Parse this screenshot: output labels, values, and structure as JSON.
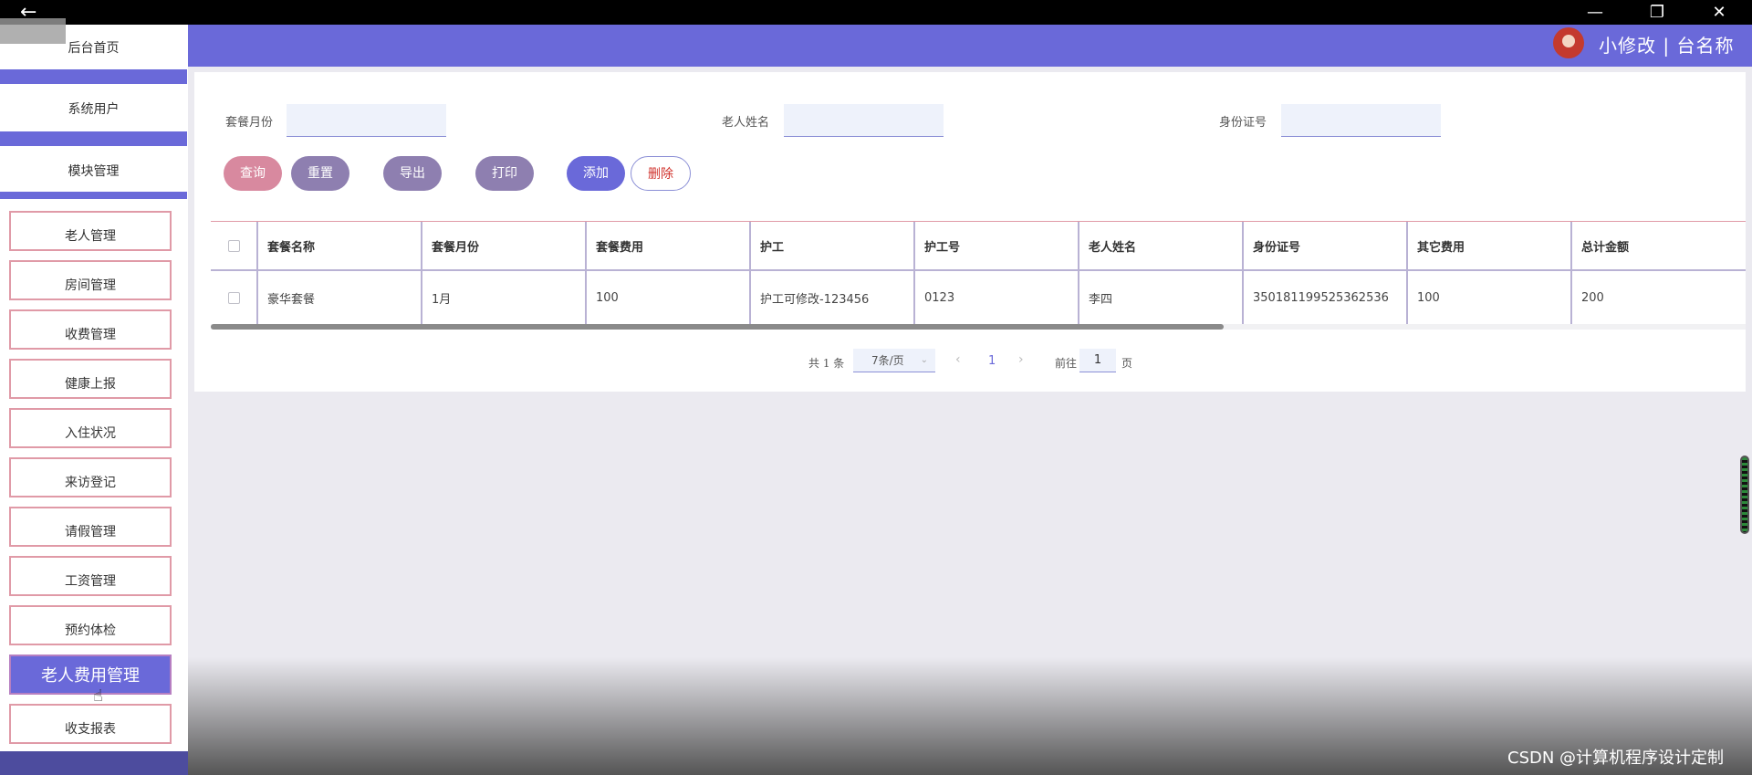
{
  "window": {
    "back_label": "←",
    "minimize_label": "—",
    "restore_label": "❐",
    "close_label": "✕"
  },
  "header": {
    "text": "小修改 | 台名称"
  },
  "sidebar": {
    "top_items": [
      "后台首页",
      "系统用户",
      "模块管理"
    ],
    "items": [
      {
        "label": "老人管理"
      },
      {
        "label": "房间管理"
      },
      {
        "label": "收费管理"
      },
      {
        "label": "健康上报"
      },
      {
        "label": "入住状况"
      },
      {
        "label": "来访登记"
      },
      {
        "label": "请假管理"
      },
      {
        "label": "工资管理"
      },
      {
        "label": "预约体检"
      },
      {
        "label": "老人费用管理",
        "active": true
      },
      {
        "label": "收支报表"
      }
    ]
  },
  "filters": {
    "package_month_label": "套餐月份",
    "elder_name_label": "老人姓名",
    "id_card_label": "身份证号",
    "package_month_value": "",
    "elder_name_value": "",
    "id_card_value": ""
  },
  "buttons": {
    "query": "查询",
    "reset": "重置",
    "export": "导出",
    "print": "打印",
    "add": "添加",
    "delete": "删除"
  },
  "table": {
    "headers": [
      "套餐名称",
      "套餐月份",
      "套餐费用",
      "护工",
      "护工号",
      "老人姓名",
      "身份证号",
      "其它费用",
      "总计金额"
    ],
    "rows": [
      [
        "豪华套餐",
        "1月",
        "100",
        "护工可修改-123456",
        "0123",
        "李四",
        "350181199525362536",
        "100",
        "200"
      ]
    ]
  },
  "pager": {
    "total": "共 1 条",
    "page_size": "7条/页",
    "prev": "‹",
    "current_page": "1",
    "next": "›",
    "goto": "前往",
    "goto_value": "1",
    "page_unit": "页"
  },
  "watermark": "CSDN @计算机程序设计定制",
  "colors": {
    "accent": "#6a69d9",
    "border_pink": "#e09aa7",
    "query_button": "#d8899f",
    "secondary_button": "#8e7fb0",
    "delete_text": "#d0322c"
  }
}
